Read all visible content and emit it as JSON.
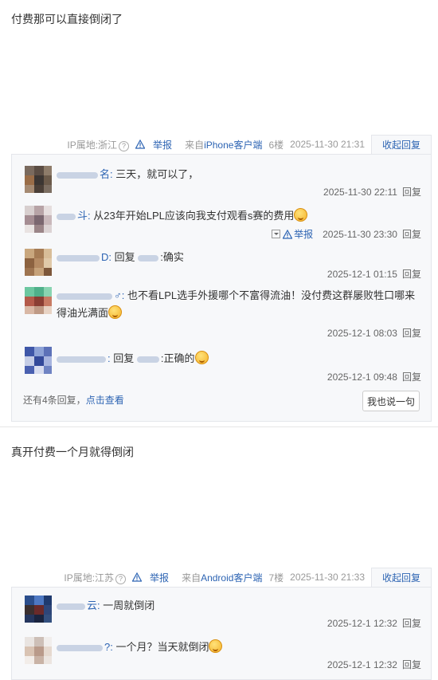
{
  "posts": [
    {
      "text": "付费那可以直接倒闭了",
      "ip": "IP属地:浙江",
      "report": "举报",
      "client_prefix": "来自",
      "client": "iPhone客户端",
      "floor": "6楼",
      "time": "2025-11-30 21:31",
      "collapse": "收起回复",
      "replies": [
        {
          "suffix": "名:",
          "text": "三天，就可以了，",
          "time": "2025-11-30 22:11",
          "reply_label": "回复"
        },
        {
          "suffix": "斗:",
          "text": "从23年开始LPL应该向我支付观看s赛的费用",
          "time": "2025-11-30 23:30",
          "reply_label": "回复",
          "report": "举报"
        },
        {
          "suffix": "D:",
          "text": "回复",
          "target_suffix": ":确实",
          "time": "2025-12-1 01:15",
          "reply_label": "回复"
        },
        {
          "suffix": "♂:",
          "text": "也不看LPL选手外援哪个不富得流油！没付费这群屡败牲口哪来得油光满面",
          "time": "2025-12-1 08:03",
          "reply_label": "回复"
        },
        {
          "suffix": ":",
          "text": "回复",
          "target_suffix": ":正确的",
          "time": "2025-12-1 09:48",
          "reply_label": "回复"
        }
      ],
      "more_prefix": "还有4条回复，",
      "more_link": "点击查看",
      "say": "我也说一句"
    },
    {
      "text": "真开付费一个月就得倒闭",
      "ip": "IP属地:江苏",
      "report": "举报",
      "client_prefix": "来自",
      "client": "Android客户端",
      "floor": "7楼",
      "time": "2025-11-30 21:33",
      "collapse": "收起回复",
      "replies": [
        {
          "suffix": "云:",
          "text": "一周就倒闭",
          "time": "2025-12-1 12:32",
          "reply_label": "回复"
        },
        {
          "suffix": "?:",
          "text": "一个月？当天就倒闭",
          "time": "2025-12-1 12:32",
          "reply_label": "回复"
        }
      ]
    }
  ],
  "icons": {
    "warning": "warning-triangle-icon",
    "question": "question-circle-icon",
    "emoji": "smiley-emoji-icon",
    "dropdown": "dropdown-icon"
  },
  "colors": {
    "link": "#2d64b3",
    "reply_bg": "#f7f8fa",
    "border": "#e4e6eb"
  }
}
